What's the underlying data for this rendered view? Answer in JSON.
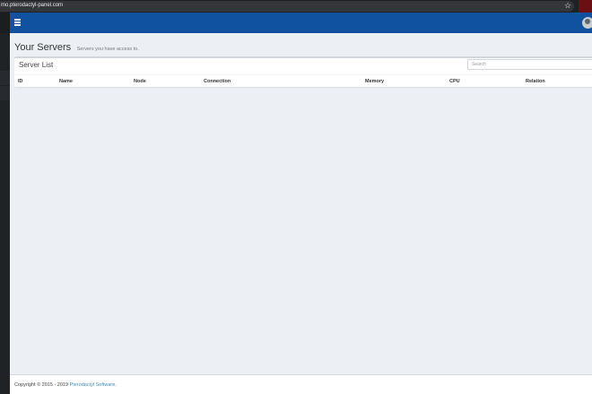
{
  "browser": {
    "url": "mo.pterodactyl-panel.com"
  },
  "header": {
    "menu_icon": "hamburger-icon",
    "avatar_icon": "user-avatar"
  },
  "page": {
    "title": "Your Servers",
    "subtitle": "Servers you have access to."
  },
  "server_list": {
    "title": "Server List",
    "search_placeholder": "Search",
    "columns": [
      "ID",
      "Name",
      "Node",
      "Connection",
      "Memory",
      "CPU",
      "Relation"
    ]
  },
  "footer": {
    "copyright": "Copyright © 2015 - 2019 ",
    "link_text": "Pterodactyl Software",
    "suffix": "."
  },
  "colors": {
    "header_bg": "#10529f",
    "content_bg": "#ecf0f5",
    "link": "#3c8dbc"
  }
}
